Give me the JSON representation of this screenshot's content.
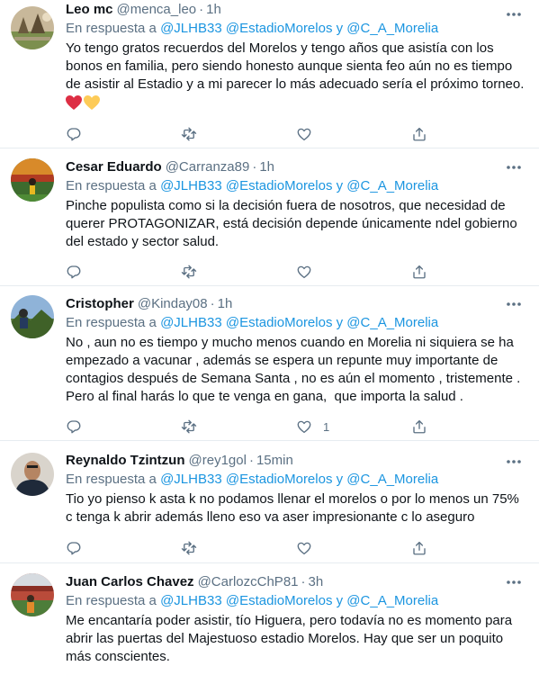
{
  "reply_prefix": "En respuesta a",
  "reply_conj": "y",
  "tweets": [
    {
      "name": "Leo mc",
      "handle": "@menca_leo",
      "time": "1h",
      "mentions": [
        "@JLHB33",
        "@EstadioMorelos",
        "@C_A_Morelia"
      ],
      "text": "Yo tengo gratos recuerdos del Morelos y tengo años que asistía con los bonos en familia, pero siendo honesto aunque sienta feo aún no es tiempo de asistir al Estadio y a mi parecer lo más adecuado sería el próximo torneo.",
      "emojis": [
        "red-heart",
        "yellow-heart"
      ],
      "like_count": ""
    },
    {
      "name": "Cesar Eduardo",
      "handle": "@Carranza89",
      "time": "1h",
      "mentions": [
        "@JLHB33",
        "@EstadioMorelos",
        "@C_A_Morelia"
      ],
      "text": "Pinche populista como si la decisión fuera de nosotros, que necesidad de querer PROTAGONIZAR, está decisión depende únicamente ndel gobierno del estado y sector salud.",
      "emojis": [],
      "like_count": ""
    },
    {
      "name": "Cristopher",
      "handle": "@Kinday08",
      "time": "1h",
      "mentions": [
        "@JLHB33",
        "@EstadioMorelos",
        "@C_A_Morelia"
      ],
      "text": "No , aun no es tiempo y mucho menos cuando en Morelia ni siquiera se ha empezado a vacunar , además se espera un repunte muy importante de contagios después de Semana Santa , no es aún el momento , tristemente .\nPero al final harás lo que te venga en gana,  que importa la salud .",
      "emojis": [],
      "like_count": "1"
    },
    {
      "name": "Reynaldo Tzintzun",
      "handle": "@rey1gol",
      "time": "15min",
      "mentions": [
        "@JLHB33",
        "@EstadioMorelos",
        "@C_A_Morelia"
      ],
      "text": "Tio yo pienso k asta k no podamos llenar el morelos o por lo menos un 75% c tenga k abrir además lleno eso va aser impresionante c lo aseguro",
      "emojis": [],
      "like_count": ""
    },
    {
      "name": "Juan Carlos Chavez",
      "handle": "@CarlozcChP81",
      "time": "3h",
      "mentions": [
        "@JLHB33",
        "@EstadioMorelos",
        "@C_A_Morelia"
      ],
      "text": "Me encantaría poder asistir, tío Higuera, pero todavía no es momento para abrir las puertas del Majestuoso estadio Morelos. Hay que ser un poquito más conscientes.",
      "emojis": [],
      "like_count": ""
    }
  ],
  "colors": {
    "link": "#1b95e0",
    "muted": "#5b7083",
    "text": "#0f1419",
    "divider": "#e6ecf0"
  }
}
